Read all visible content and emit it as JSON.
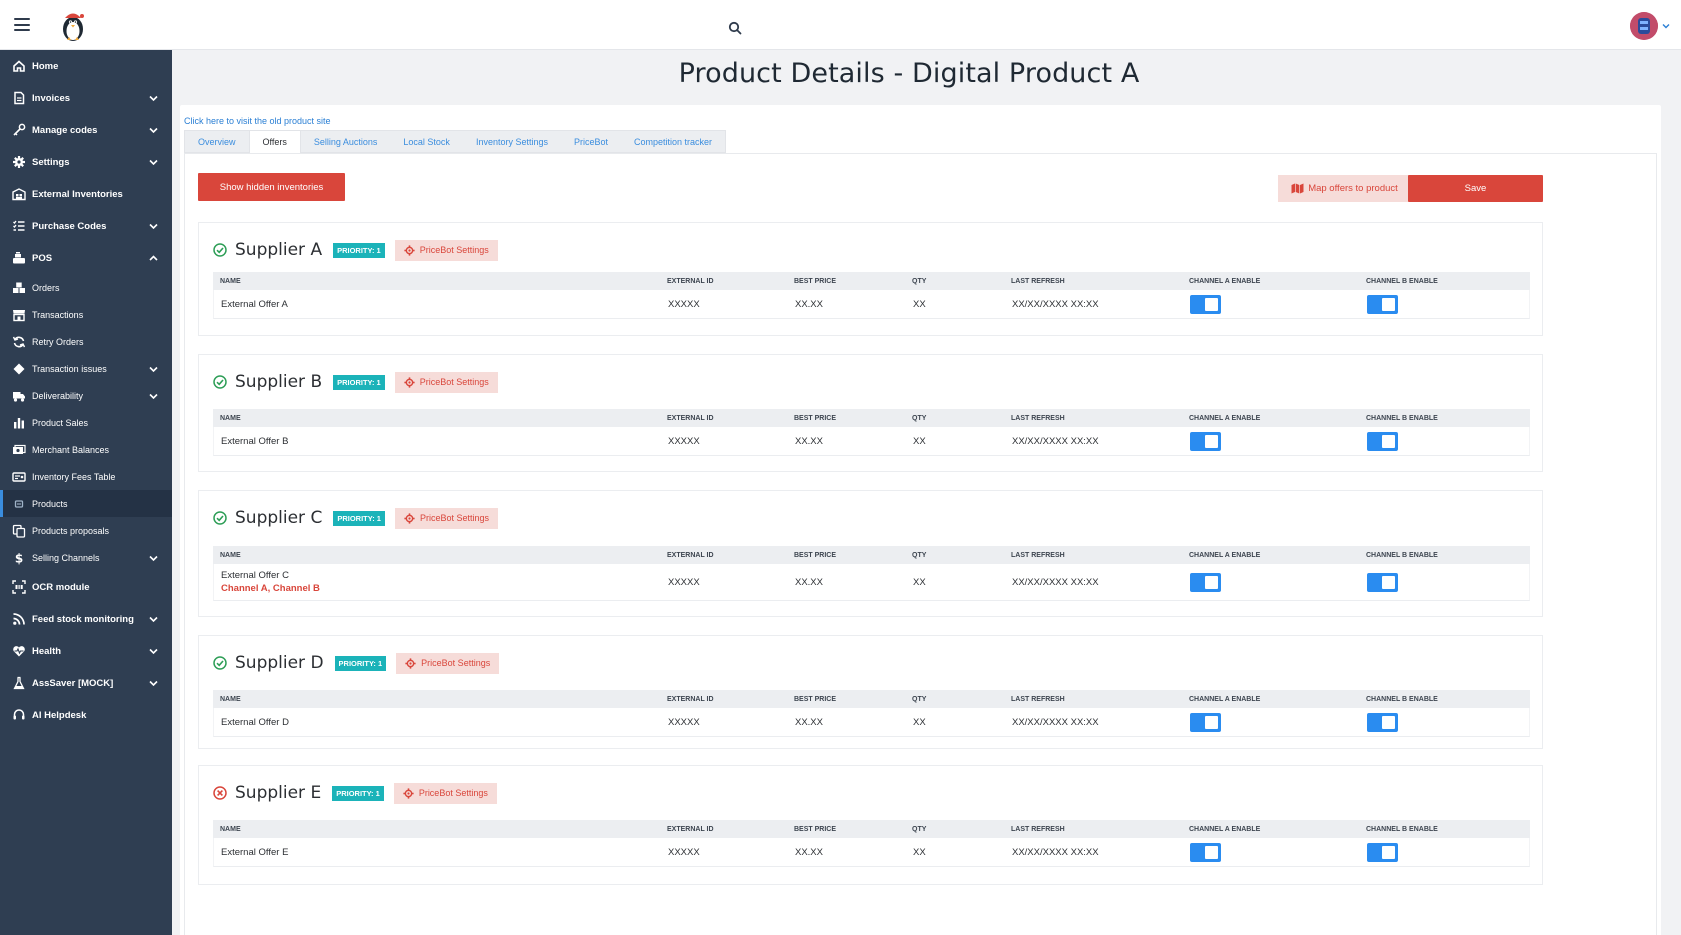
{
  "sidebar": {
    "items": [
      {
        "label": "Home",
        "icon": "home-icon",
        "type": "main",
        "chevron": false
      },
      {
        "label": "Invoices",
        "icon": "document-icon",
        "type": "main",
        "chevron": true
      },
      {
        "label": "Manage codes",
        "icon": "key-icon",
        "type": "main",
        "chevron": true
      },
      {
        "label": "Settings",
        "icon": "gear-icon",
        "type": "main",
        "chevron": true
      },
      {
        "label": "External Inventories",
        "icon": "warehouse-icon",
        "type": "main",
        "chevron": false
      },
      {
        "label": "Purchase Codes",
        "icon": "list-icon",
        "type": "main",
        "chevron": true
      },
      {
        "label": "POS",
        "icon": "cash-register-icon",
        "type": "main",
        "chevron": true,
        "expanded": true
      },
      {
        "label": "Orders",
        "icon": "boxes-icon",
        "type": "sub",
        "chevron": false
      },
      {
        "label": "Transactions",
        "icon": "store-icon",
        "type": "sub",
        "chevron": false
      },
      {
        "label": "Retry Orders",
        "icon": "refresh-icon",
        "type": "sub",
        "chevron": false
      },
      {
        "label": "Transaction issues",
        "icon": "diamond-icon",
        "type": "sub",
        "chevron": true
      },
      {
        "label": "Deliverability",
        "icon": "truck-icon",
        "type": "sub",
        "chevron": true
      },
      {
        "label": "Product Sales",
        "icon": "bar-chart-icon",
        "type": "sub",
        "chevron": false
      },
      {
        "label": "Merchant Balances",
        "icon": "money-icon",
        "type": "sub",
        "chevron": false
      },
      {
        "label": "Inventory Fees Table",
        "icon": "money-check-icon",
        "type": "sub",
        "chevron": false
      },
      {
        "label": "Products",
        "icon": "product-icon",
        "type": "sub",
        "chevron": false,
        "active": true
      },
      {
        "label": "Products proposals",
        "icon": "copy-icon",
        "type": "sub",
        "chevron": false
      },
      {
        "label": "Selling Channels",
        "icon": "dollar-icon",
        "type": "sub",
        "chevron": true
      },
      {
        "label": "OCR module",
        "icon": "scan-icon",
        "type": "main",
        "chevron": false
      },
      {
        "label": "Feed stock monitoring",
        "icon": "rss-icon",
        "type": "main",
        "chevron": true
      },
      {
        "label": "Health",
        "icon": "heartbeat-icon",
        "type": "main",
        "chevron": true
      },
      {
        "label": "AssSaver [MOCK]",
        "icon": "flask-icon",
        "type": "main",
        "chevron": true
      },
      {
        "label": "AI Helpdesk",
        "icon": "headset-icon",
        "type": "main",
        "chevron": false
      }
    ]
  },
  "page": {
    "title": "Product Details - Digital Product A",
    "old_link": "Click here to visit the old product site"
  },
  "tabs": [
    {
      "label": "Overview",
      "active": false
    },
    {
      "label": "Offers",
      "active": true
    },
    {
      "label": "Selling Auctions",
      "active": false
    },
    {
      "label": "Local Stock",
      "active": false
    },
    {
      "label": "Inventory Settings",
      "active": false
    },
    {
      "label": "PriceBot",
      "active": false
    },
    {
      "label": "Competition tracker",
      "active": false
    }
  ],
  "actions": {
    "show_hidden": "Show hidden inventories",
    "map_offers": "Map offers to product",
    "save": "Save"
  },
  "columns": {
    "name": "NAME",
    "external_id": "EXTERNAL ID",
    "best_price": "BEST PRICE",
    "qty": "QTY",
    "last_refresh": "LAST REFRESH",
    "channel_a": "CHANNEL A ENABLE",
    "channel_b": "CHANNEL B ENABLE"
  },
  "suppliers": [
    {
      "name": "Supplier A",
      "status": "ok",
      "priority": "PRIORITY: 1",
      "pricebot": "PriceBot Settings",
      "offer": {
        "name": "External Offer A",
        "channels": "",
        "external_id": "XXXXX",
        "best_price": "XX.XX",
        "qty": "XX",
        "last_refresh": "XX/XX/XXXX XX:XX",
        "channel_a": true,
        "channel_b": true
      }
    },
    {
      "name": "Supplier B",
      "status": "ok",
      "priority": "PRIORITY: 1",
      "pricebot": "PriceBot Settings",
      "offer": {
        "name": "External Offer B",
        "channels": "",
        "external_id": "XXXXX",
        "best_price": "XX.XX",
        "qty": "XX",
        "last_refresh": "XX/XX/XXXX XX:XX",
        "channel_a": true,
        "channel_b": true
      }
    },
    {
      "name": "Supplier C",
      "status": "ok",
      "priority": "PRIORITY: 1",
      "pricebot": "PriceBot Settings",
      "offer": {
        "name": "External Offer C",
        "channels": "Channel A, Channel B",
        "external_id": "XXXXX",
        "best_price": "XX.XX",
        "qty": "XX",
        "last_refresh": "XX/XX/XXXX XX:XX",
        "channel_a": true,
        "channel_b": true
      }
    },
    {
      "name": "Supplier D",
      "status": "ok",
      "priority": "PRIORITY: 1",
      "pricebot": "PriceBot Settings",
      "offer": {
        "name": "External Offer D",
        "channels": "",
        "external_id": "XXXXX",
        "best_price": "XX.XX",
        "qty": "XX",
        "last_refresh": "XX/XX/XXXX XX:XX",
        "channel_a": true,
        "channel_b": true
      }
    },
    {
      "name": "Supplier E",
      "status": "error",
      "priority": "PRIORITY: 1",
      "pricebot": "PriceBot Settings",
      "offer": {
        "name": "External Offer E",
        "channels": "",
        "external_id": "XXXXX",
        "best_price": "XX.XX",
        "qty": "XX",
        "last_refresh": "XX/XX/XXXX XX:XX",
        "channel_a": true,
        "channel_b": true
      }
    }
  ],
  "colors": {
    "sidebar_bg": "#2f3e52",
    "accent_red": "#d9463b",
    "priority_teal": "#1bb3b9",
    "toggle_blue": "#2a8cf0",
    "link_blue": "#2a7fd4",
    "status_ok": "#2e9e57",
    "status_error": "#d9463b"
  }
}
